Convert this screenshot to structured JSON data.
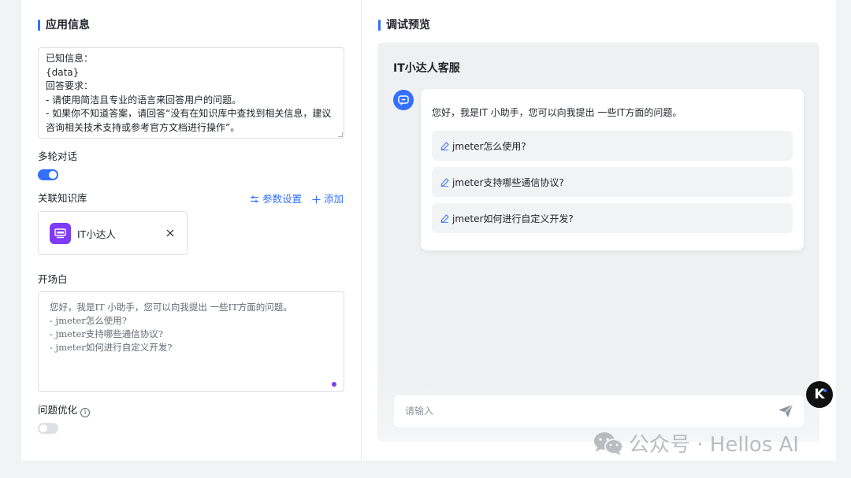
{
  "app_info": {
    "title": "应用信息",
    "prompt_lines": [
      "已知信息：",
      "{data}",
      "回答要求：",
      "- 请使用简洁且专业的语言来回答用户的问题。",
      "- 如果你不知道答案，请回答“没有在知识库中查找到相关信息，建议咨询相关技术支持或参考官方文档进行操作”。"
    ],
    "multi_turn_label": "多轮对话",
    "multi_turn_enabled": true,
    "knowledge_label": "关联知识库",
    "param_settings_label": "参数设置",
    "add_label": "添加",
    "knowledge_items": [
      {
        "name": "IT小达人"
      }
    ],
    "opening_label": "开场白",
    "opening_lines": [
      "您好，我是IT  小助手，您可以向我提出 一些IT方面的问题。",
      "- jmeter怎么使用?",
      "- jmeter支持哪些通信协议?",
      "- jmeter如何进行自定义开发?"
    ],
    "question_opt_label": "问题优化",
    "question_opt_enabled": false
  },
  "preview": {
    "title": "调试预览",
    "bot_name": "IT小达人客服",
    "greeting": "您好，我是IT 小助手，您可以向我提出 一些IT方面的问题。",
    "suggestions": [
      "jmeter怎么使用?",
      "jmeter支持哪些通信协议?",
      "jmeter如何进行自定义开发?"
    ],
    "input_placeholder": "请输入"
  },
  "watermark": {
    "text": "公众号 · Hellos AI",
    "logo_letter": "K"
  },
  "colors": {
    "accent": "#3370ff",
    "kb_icon": "#7f3bf5"
  }
}
